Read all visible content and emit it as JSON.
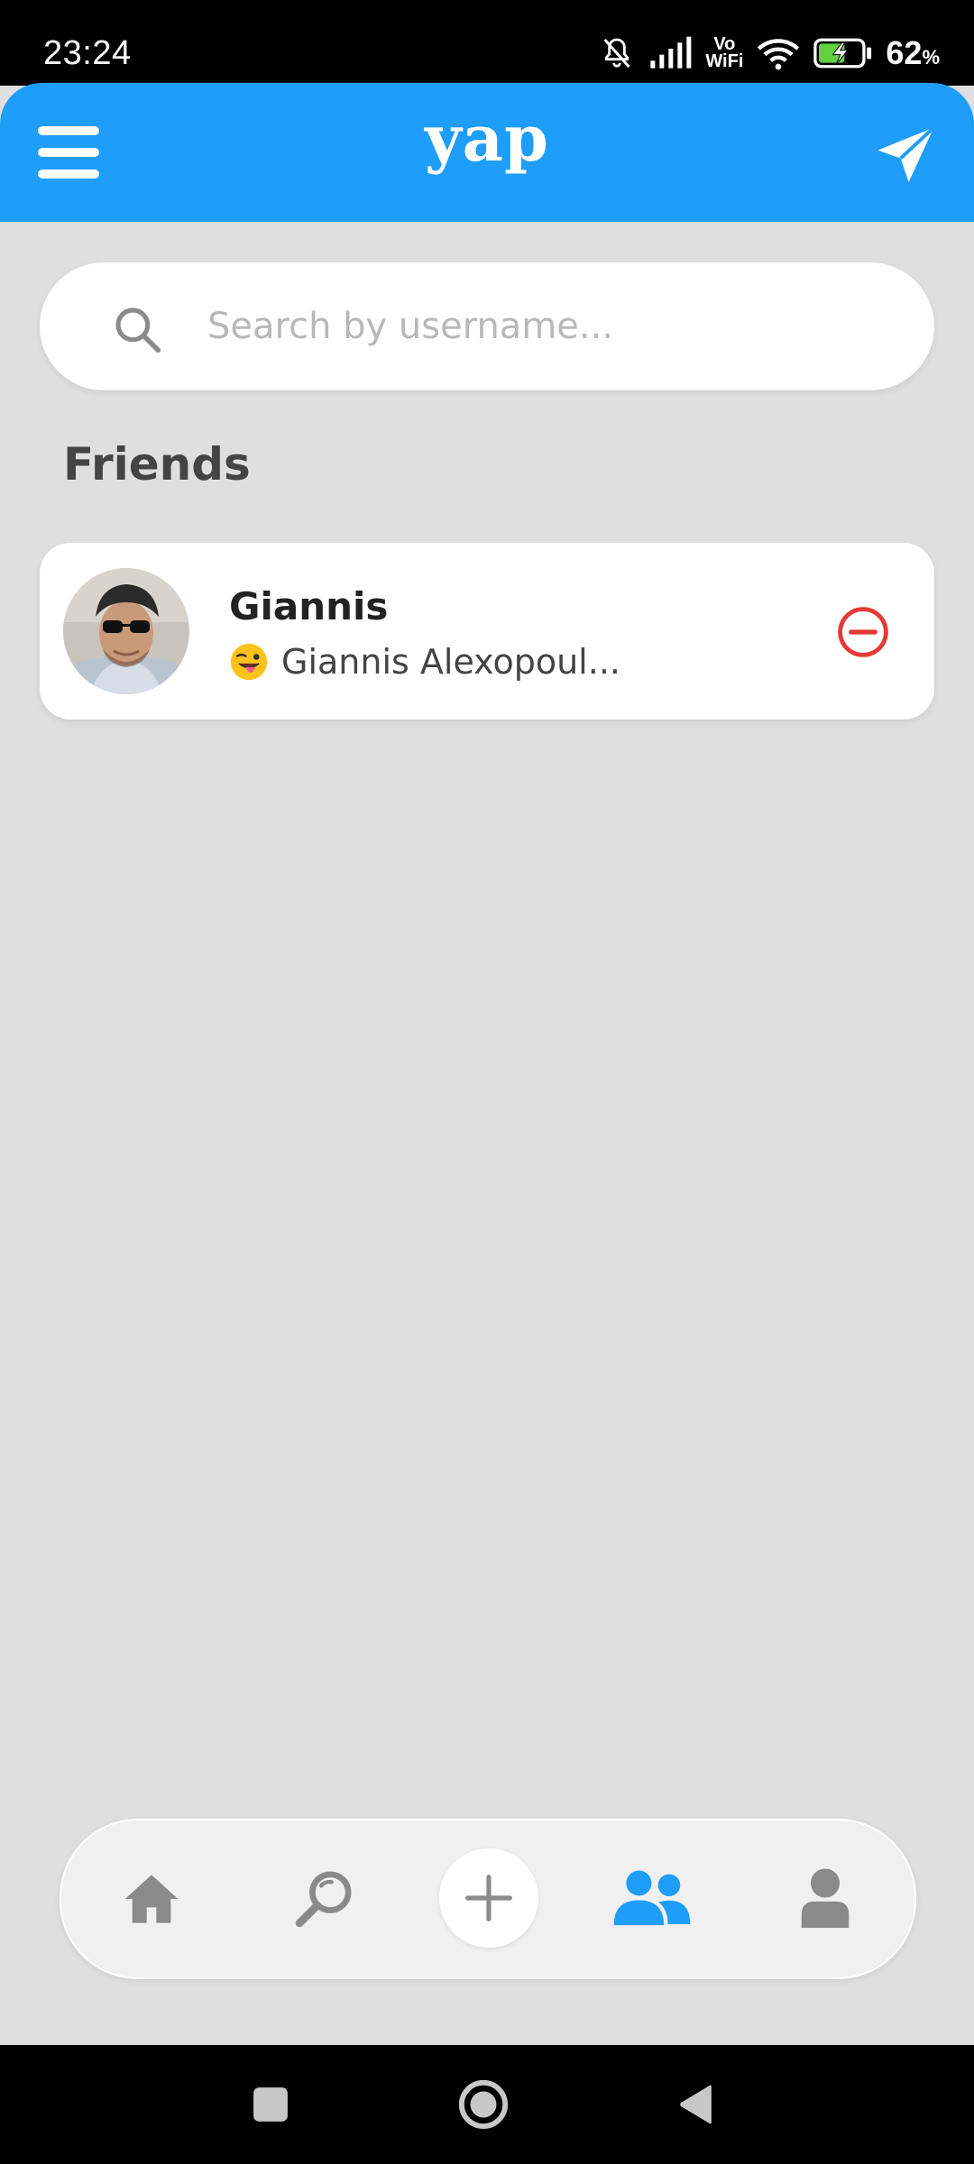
{
  "status_bar": {
    "time": "23:24",
    "network_label_top": "Vo",
    "network_label_bottom": "WiFi",
    "battery_percent": "62",
    "battery_unit": "%",
    "battery_level": 0.62,
    "icons": [
      "bell-off-icon",
      "signal-icon",
      "wifi-icon",
      "battery-charging-icon"
    ]
  },
  "app_bar": {
    "title": "yap",
    "menu_icon": "hamburger-menu-icon",
    "action_icon": "send-icon"
  },
  "search": {
    "placeholder": "Search by username...",
    "value": "",
    "icon": "search-icon"
  },
  "friends": {
    "title": "Friends",
    "items": [
      {
        "name": "Giannis",
        "status_emoji": "winking-face-with-tongue",
        "status_text": "Giannis Alexopoul...",
        "avatar": "profile-photo",
        "action_icon": "remove-circle-icon"
      }
    ]
  },
  "bottom_nav": {
    "active": "friends",
    "items": [
      "home",
      "search",
      "add",
      "friends",
      "profile"
    ],
    "colors": {
      "active": "#1e9df9",
      "inactive": "#8a8a8a"
    }
  },
  "colors": {
    "accent": "#1e9df9",
    "background": "#dfdfdf",
    "danger": "#e53935"
  }
}
